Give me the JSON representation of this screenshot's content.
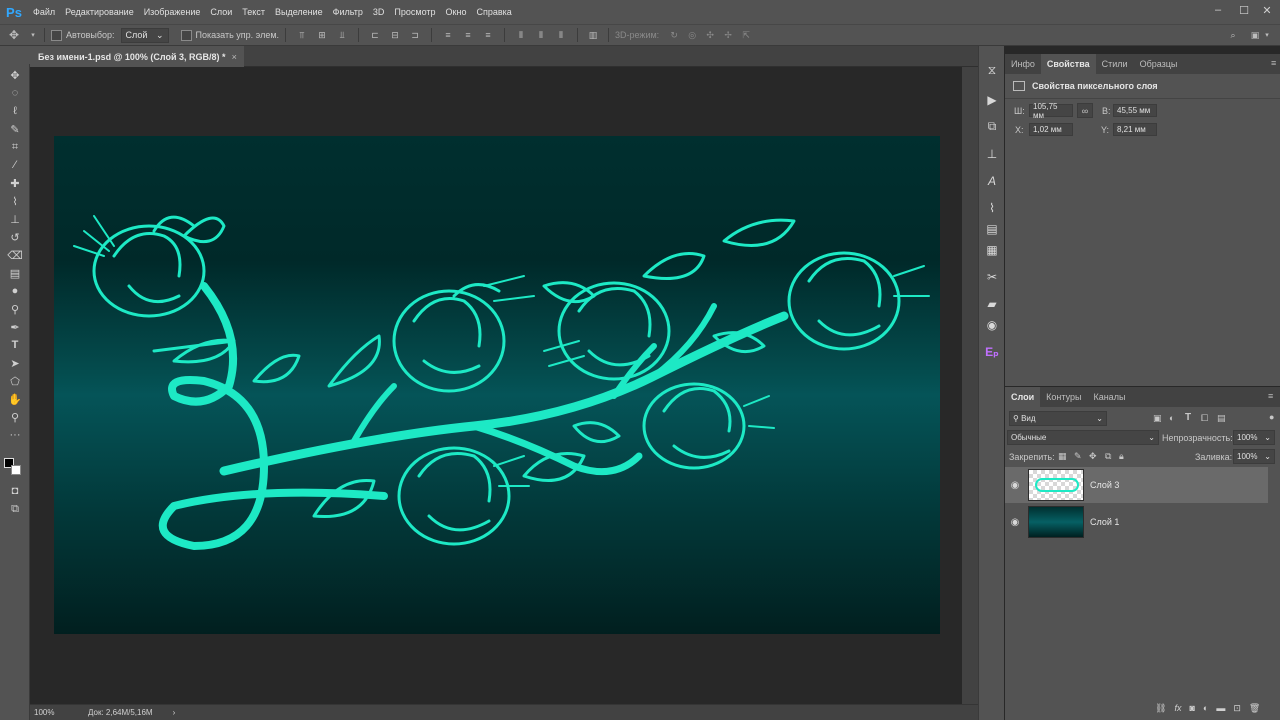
{
  "app": {
    "logo": "Ps"
  },
  "menu": [
    "Файл",
    "Редактирование",
    "Изображение",
    "Слои",
    "Текст",
    "Выделение",
    "Фильтр",
    "3D",
    "Просмотр",
    "Окно",
    "Справка"
  ],
  "window_controls": {
    "minimize": "–",
    "maximize": "☐",
    "close": "✕"
  },
  "options": {
    "autoselect_label": "Автовыбор:",
    "autoselect_value": "Слой",
    "show_controls_label": "Показать упр. элем.",
    "mode_3d_label": "3D-режим:"
  },
  "document": {
    "tab_title": "Без имени-1.psd @ 100% (Слой 3, RGB/8) *",
    "tab_close": "×"
  },
  "status": {
    "zoom": "100%",
    "doc_info": "Док: 2,64M/5,16M",
    "arrow": "›"
  },
  "properties": {
    "tabs": [
      "Инфо",
      "Свойства",
      "Стили",
      "Образцы"
    ],
    "active_tab": "Свойства",
    "title": "Свойства пиксельного слоя",
    "w_label": "Ш:",
    "w_value": "105,75 мм",
    "h_label": "В:",
    "h_value": "45,55 мм",
    "x_label": "X:",
    "x_value": "1,02 мм",
    "y_label": "Y:",
    "y_value": "8,21 мм"
  },
  "layers_panel": {
    "tabs": [
      "Слои",
      "Контуры",
      "Каналы"
    ],
    "active_tab": "Слои",
    "filter": "Вид",
    "blend_mode": "Обычные",
    "opacity_label": "Непрозрачность:",
    "opacity_value": "100%",
    "lock_label": "Закрепить:",
    "fill_label": "Заливка:",
    "fill_value": "100%",
    "layers": [
      {
        "name": "Слой 3",
        "selected": true
      },
      {
        "name": "Слой 1",
        "selected": false
      }
    ],
    "bottom_fx": "fx"
  },
  "colors": {
    "accent": "#31a8ff",
    "flower": "#1de9c5",
    "canvas_dark": "#002929",
    "canvas_mid": "#055458"
  }
}
